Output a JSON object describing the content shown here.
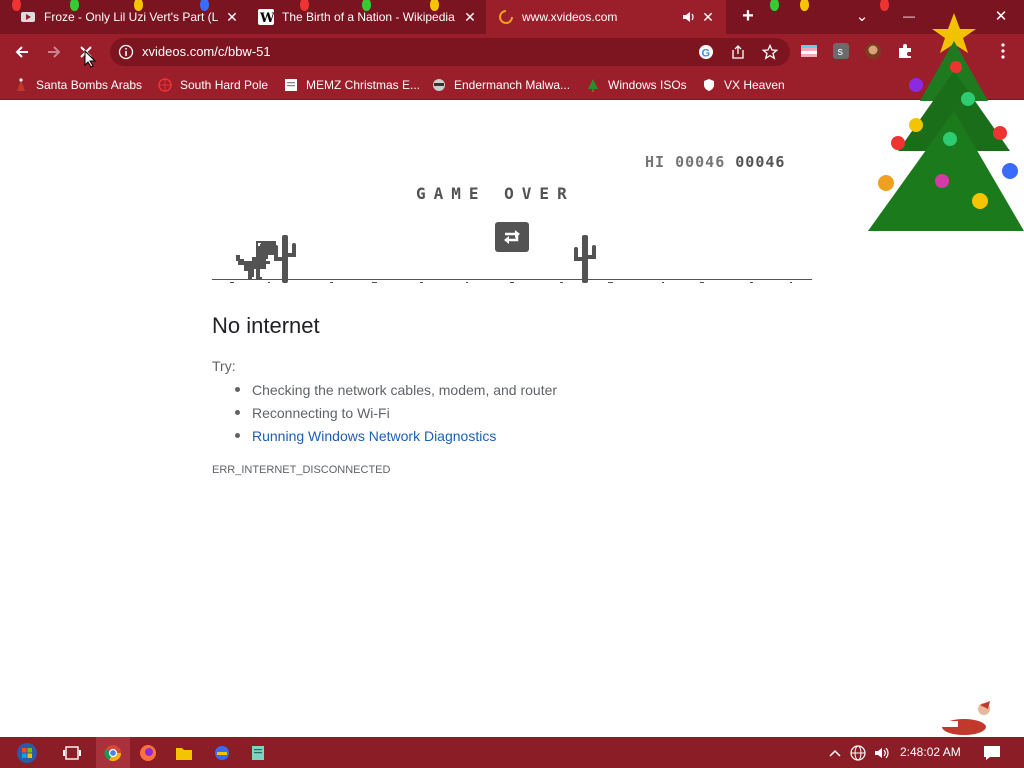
{
  "tabs": [
    {
      "title": "Froze - Only Lil Uzi Vert's Part (L",
      "favicon": "video-favicon",
      "close": "✕"
    },
    {
      "title": "The Birth of a Nation - Wikipedia",
      "favicon": "wikipedia-favicon",
      "close": "✕"
    },
    {
      "title": "www.xvideos.com",
      "favicon": "loading-favicon",
      "close": "✕",
      "active": true,
      "audio": "speaker-icon"
    }
  ],
  "tabstrip": {
    "new_tab": "+",
    "tab_search": "⌄",
    "minimize": "—",
    "close": "✕"
  },
  "toolbar": {
    "url": "xvideos.com/c/bbw-51"
  },
  "bookmarks": [
    {
      "label": "Santa Bombs Arabs",
      "icon": "santa-icon"
    },
    {
      "label": "South Hard Pole",
      "icon": "globe-icon"
    },
    {
      "label": "MEMZ Christmas E...",
      "icon": "document-icon"
    },
    {
      "label": "Endermanch Malwa...",
      "icon": "raccoon-icon"
    },
    {
      "label": "Windows ISOs",
      "icon": "tree-icon"
    },
    {
      "label": "VX Heaven",
      "icon": "shield-icon"
    }
  ],
  "game": {
    "hi_label": "HI",
    "hi_score": "00046",
    "score": "00046",
    "game_over": "GAME OVER"
  },
  "error": {
    "title": "No internet",
    "try_label": "Try:",
    "suggestions": [
      "Checking the network cables, modem, and router",
      "Reconnecting to Wi-Fi",
      "Running Windows Network Diagnostics"
    ],
    "code": "ERR_INTERNET_DISCONNECTED"
  },
  "taskbar": {
    "time": "2:48:02 AM"
  },
  "colors": {
    "tab_strip": "#7a1420",
    "toolbar": "#9b1e2b",
    "link": "#1a5fb4",
    "dino": "#535353",
    "taskbar": "#8a1d26"
  }
}
